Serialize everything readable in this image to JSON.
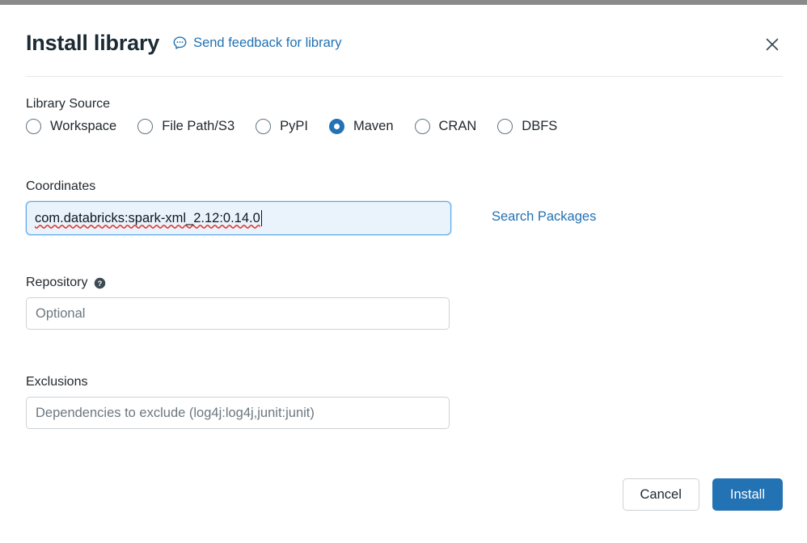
{
  "header": {
    "title": "Install library",
    "feedback_label": "Send feedback for library",
    "feedback_icon": "speech-bubble-icon",
    "close_icon": "close-icon"
  },
  "library_source": {
    "label": "Library Source",
    "options": [
      {
        "label": "Workspace",
        "selected": false
      },
      {
        "label": "File Path/S3",
        "selected": false
      },
      {
        "label": "PyPI",
        "selected": false
      },
      {
        "label": "Maven",
        "selected": true
      },
      {
        "label": "CRAN",
        "selected": false
      },
      {
        "label": "DBFS",
        "selected": false
      }
    ],
    "selected_value": "Maven"
  },
  "coordinates": {
    "label": "Coordinates",
    "value": "com.databricks:spark-xml_2.12:0.14.0",
    "focused": true,
    "search_link": "Search Packages"
  },
  "repository": {
    "label": "Repository",
    "help_icon": "help-circle-icon",
    "placeholder": "Optional",
    "value": ""
  },
  "exclusions": {
    "label": "Exclusions",
    "placeholder": "Dependencies to exclude (log4j:log4j,junit:junit)",
    "value": ""
  },
  "footer": {
    "cancel_label": "Cancel",
    "install_label": "Install"
  },
  "colors": {
    "accent": "#2272b4",
    "link": "#2272b4",
    "text": "#1f272d",
    "border": "#cdd2d6",
    "focus_border": "#5ba7e8",
    "focus_fill": "#eaf3fc",
    "spellcheck": "#e03b2f"
  }
}
